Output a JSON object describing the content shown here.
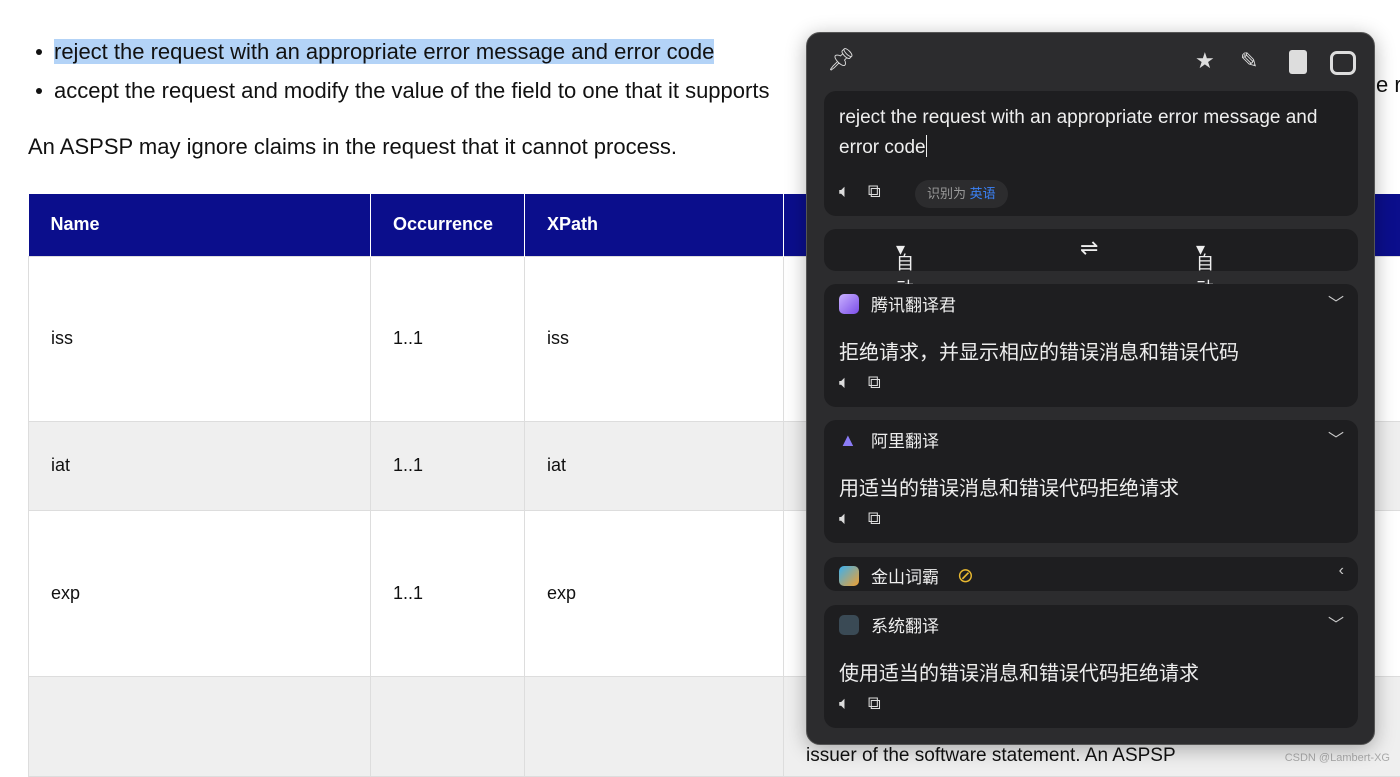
{
  "document": {
    "bullets": [
      "reject the request with an appropriate error message and error code",
      "accept the request and modify the value of the field to one that it supports"
    ],
    "bullet2_tail": "e r",
    "paragraph": "An ASPSP may ignore claims in the request that it cannot process.",
    "table": {
      "headers": [
        "Name",
        "Occurrence",
        "XPath",
        ""
      ],
      "rows": [
        [
          "iss",
          "1..1",
          "iss",
          ")"
        ],
        [
          "iat",
          "1..1",
          "iat",
          ""
        ],
        [
          "exp",
          "1..1",
          "exp",
          ""
        ],
        [
          "",
          "",
          "",
          ""
        ]
      ]
    },
    "issuer_text": "issuer of the software statement. An ASPSP",
    "watermark": "CSDN @Lambert-XG",
    "colors": {
      "header": "#0b0e8c",
      "highlight": "#b3d3f7"
    }
  },
  "panel": {
    "toolbar_icons": [
      "pin-icon",
      "star-icon",
      "eraser-icon",
      "bookmark-icon",
      "toggle-icon"
    ],
    "source_text": "reject the request with an appropriate error message and error code",
    "detected_label": "识别为",
    "detected_lang": "英语",
    "source_lang": "自动检测",
    "target_lang": "自动选择",
    "swap": "⇌",
    "engines": [
      {
        "name": "腾讯翻译君",
        "result": "拒绝请求，并显示相应的错误消息和错误代码",
        "expanded": true
      },
      {
        "name": "阿里翻译",
        "result": "用适当的错误消息和错误代码拒绝请求",
        "expanded": true
      },
      {
        "name": "金山词霸",
        "result": "",
        "expanded": false,
        "disabled": true
      },
      {
        "name": "系统翻译",
        "result": "使用适当的错误消息和错误代码拒绝请求",
        "expanded": true
      }
    ]
  }
}
